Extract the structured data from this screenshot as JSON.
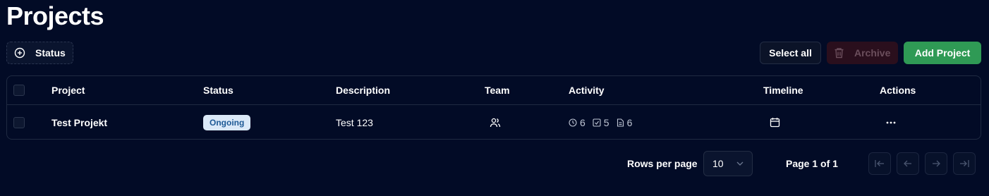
{
  "page": {
    "title": "Projects"
  },
  "filters": {
    "status_label": "Status"
  },
  "toolbar": {
    "select_all_label": "Select all",
    "archive_label": "Archive",
    "add_project_label": "Add Project"
  },
  "table": {
    "columns": [
      "Project",
      "Status",
      "Description",
      "Team",
      "Activity",
      "Timeline",
      "Actions"
    ],
    "rows": [
      {
        "project": "Test Projekt",
        "status": "Ongoing",
        "description": "Test 123",
        "activity": {
          "time": "6",
          "tasks": "5",
          "files": "6"
        }
      }
    ]
  },
  "pagination": {
    "rows_per_page_label": "Rows per page",
    "rows_per_page_value": "10",
    "page_info": "Page 1 of 1"
  },
  "colors": {
    "background": "#020b26",
    "accent_green": "#2f9a55",
    "badge_bg": "#dbe9f8",
    "badge_text": "#1e5a96"
  }
}
